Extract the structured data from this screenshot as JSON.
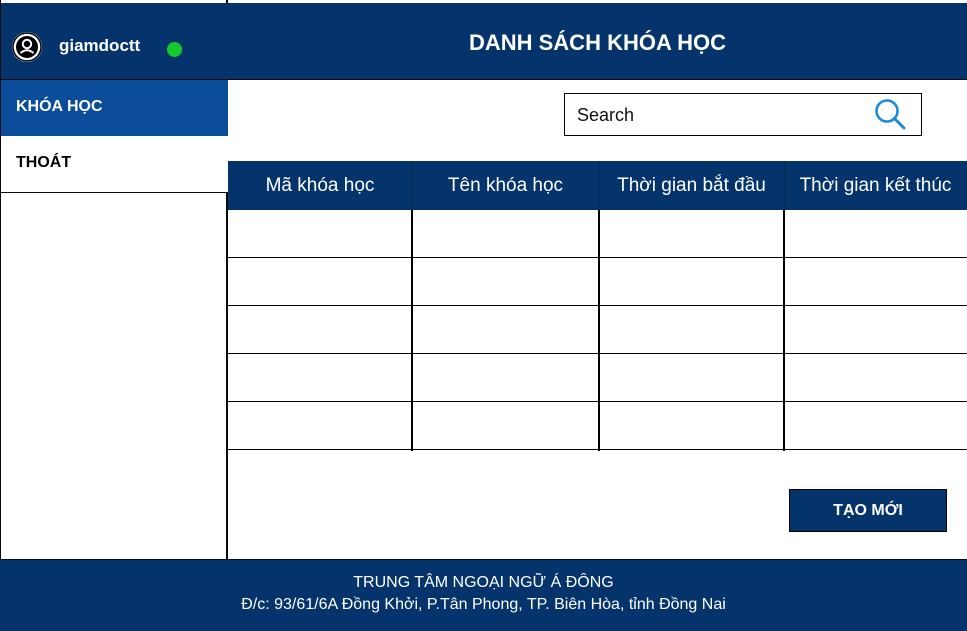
{
  "user": {
    "username": "giamdoctt",
    "status_color": "#14c92a"
  },
  "sidebar": {
    "items": [
      {
        "label": "KHÓA HỌC",
        "active": true
      },
      {
        "label": "THOÁT",
        "active": false
      }
    ]
  },
  "header": {
    "title": "DANH SÁCH KHÓA HỌC"
  },
  "search": {
    "placeholder": "Search",
    "value": "",
    "icon": "search-icon"
  },
  "table": {
    "columns": [
      "Mã khóa học",
      "Tên khóa học",
      "Thời gian bắt đầu",
      "Thời gian kết thúc"
    ],
    "rows": [
      [
        "",
        "",
        "",
        ""
      ],
      [
        "",
        "",
        "",
        ""
      ],
      [
        "",
        "",
        "",
        ""
      ],
      [
        "",
        "",
        "",
        ""
      ],
      [
        "",
        "",
        "",
        ""
      ]
    ]
  },
  "actions": {
    "create_label": "TẠO MỚI"
  },
  "footer": {
    "line1": "TRUNG TÂM NGOẠI NGỮ Á ĐÔNG",
    "line2": "Đ/c: 93/61/6A Đồng Khởi, P.Tân Phong, TP. Biên Hòa, tỉnh Đồng Nai"
  },
  "colors": {
    "primary": "#04346b",
    "active": "#0b4d9a",
    "accent_icon": "#1a8be0"
  }
}
